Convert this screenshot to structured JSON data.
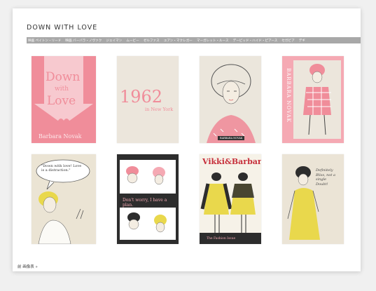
{
  "site": {
    "title": "DOWN WITH LOVE"
  },
  "nav": {
    "items": [
      "映画 ペイトン・リード",
      "映画 バーバラ・ノヴァク",
      "ジェイマン",
      "ムービー",
      "ゼルファス",
      "ユアン・マクレガー",
      "マーガレット・ルース",
      "デービッド・ハイド・ピアース",
      "セガビア",
      "デギ"
    ]
  },
  "covers": [
    {
      "name": "cover-down-with-love",
      "title_line1": "Down",
      "title_line2": "with",
      "title_line3": "Love",
      "author": "Barbara Novak"
    },
    {
      "name": "cover-1962",
      "year": "1962",
      "place": "in New York"
    },
    {
      "name": "cover-woman-hat",
      "caption": "BARBARA NOVAK"
    },
    {
      "name": "cover-barbara-novak",
      "side_text": "BARBARA NOVAK"
    },
    {
      "name": "cover-speech-bubble",
      "bubble": "\"Down with love! Love is a distraction.\""
    },
    {
      "name": "cover-dont-worry",
      "text": "Don't worry, I have a plan."
    },
    {
      "name": "cover-vikki-barbara",
      "title": "Vikki&Barbara",
      "footer": "The Fashion Issue"
    },
    {
      "name": "cover-yellow-dress",
      "note": "Definitely Bliss, not a single Doubt!"
    }
  ],
  "footer": {
    "link": "前 画像表 »"
  },
  "colors": {
    "pink": "#f08d9a",
    "pink_light": "#f5a9b3",
    "paper": "#e8e2d6",
    "dark": "#2d2d2d",
    "yellow": "#e9d84c",
    "nav_bg": "#a8a8a8"
  }
}
